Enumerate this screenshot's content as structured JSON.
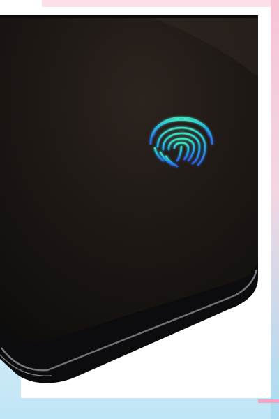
{
  "photo": {
    "subject": "phone-screen-with-fingerprint-sensor"
  },
  "fingerprint_icon": {
    "icon": "fingerprint-icon",
    "colors": {
      "top": "#3fe0c0",
      "middle": "#22a8e6",
      "bottom": "#2f5fe0"
    }
  },
  "colors": {
    "frame_pink": "#f6c7d8",
    "frame_blue": "#b8e2f4",
    "screen_black": "#1a1512",
    "phone_bezel": "#0d0d0f"
  }
}
